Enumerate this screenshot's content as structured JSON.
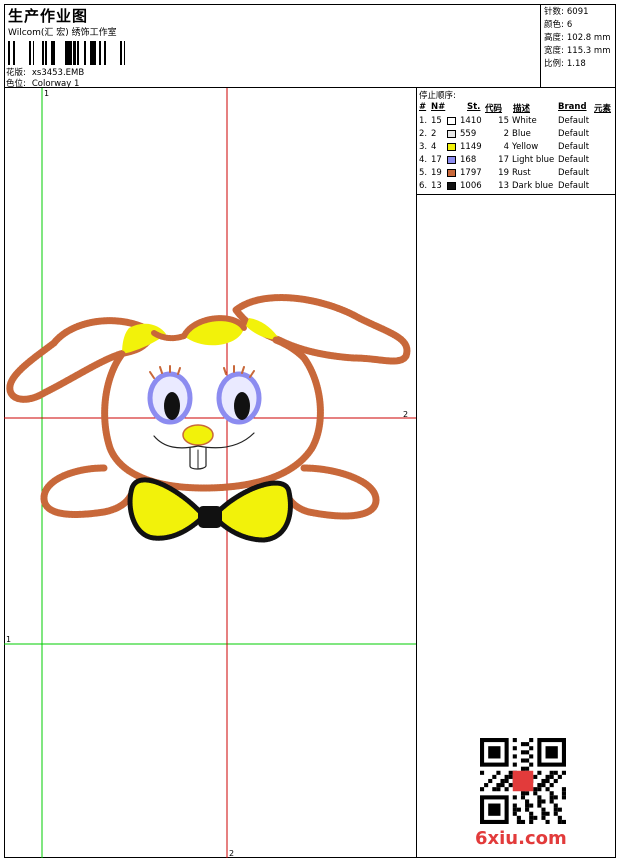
{
  "header": {
    "title": "生产作业图",
    "company": "Wilcom(汇 宏) 绣饰工作室",
    "design_label": "花版:",
    "design_value": "xs3453.EMB",
    "colorway_label": "色位:",
    "colorway_value": "Colorway 1"
  },
  "stats": {
    "stitches_label": "针数:",
    "stitches_value": "6091",
    "colors_label": "颜色:",
    "colors_value": "6",
    "height_label": "高度:",
    "height_value": "102.8 mm",
    "width_label": "宽度:",
    "width_value": "115.3 mm",
    "scale_label": "比例:",
    "scale_value": "1.18"
  },
  "sequence": {
    "title": "停止顺序:",
    "headers": {
      "num": "#",
      "n": "N#",
      "st": "St.",
      "code": "代码",
      "desc": "描述",
      "brand": "Brand",
      "elem": "元素"
    },
    "rows": [
      {
        "idx": "1.",
        "n": "15",
        "color": "#ffffff",
        "st": "1410",
        "code": "15",
        "desc": "White",
        "brand": "Default"
      },
      {
        "idx": "2.",
        "n": "2",
        "color": "#e8e8e8",
        "st": "559",
        "code": "2",
        "desc": "Blue",
        "brand": "Default"
      },
      {
        "idx": "3.",
        "n": "4",
        "color": "#f2f20a",
        "st": "1149",
        "code": "4",
        "desc": "Yellow",
        "brand": "Default"
      },
      {
        "idx": "4.",
        "n": "17",
        "color": "#8c8cf0",
        "st": "168",
        "code": "17",
        "desc": "Light blue",
        "brand": "Default"
      },
      {
        "idx": "5.",
        "n": "19",
        "color": "#c8683a",
        "st": "1797",
        "code": "19",
        "desc": "Rust",
        "brand": "Default"
      },
      {
        "idx": "6.",
        "n": "13",
        "color": "#111111",
        "st": "1006",
        "code": "13",
        "desc": "Dark blue",
        "brand": "Default"
      }
    ]
  },
  "guides": {
    "green_v_label": "1",
    "green_h_label": "1",
    "red_h_label": "2",
    "red_v_label": "2"
  },
  "colors": {
    "outline_brown": "#c8683a",
    "yellow": "#f2f20a",
    "guide_green": "#00cc00",
    "guide_red": "#cc0000",
    "watermark": "#e23b3b"
  },
  "watermark": "6xiu.com"
}
